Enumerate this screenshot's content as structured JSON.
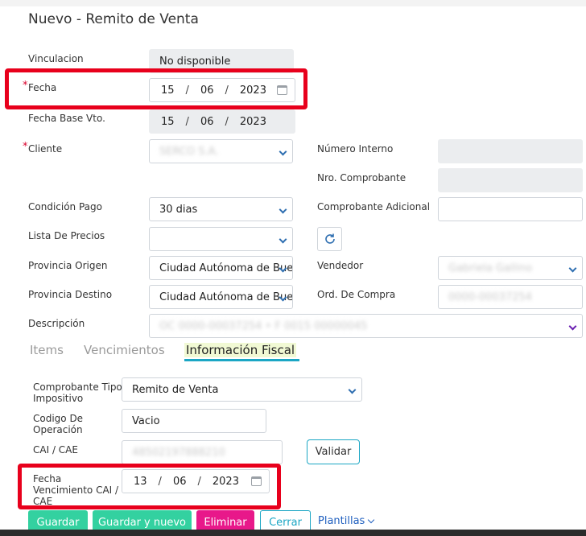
{
  "header": {
    "title": "Nuevo - Remito de Venta"
  },
  "form": {
    "vinculacion": {
      "label": "Vinculacion",
      "value": "No disponible"
    },
    "fecha": {
      "label": "Fecha",
      "day": "15",
      "month": "06",
      "year": "2023"
    },
    "fecha_base_vto": {
      "label": "Fecha Base Vto.",
      "day": "15",
      "month": "06",
      "year": "2023"
    },
    "cliente": {
      "label": "Cliente",
      "value": "SERCO S.A."
    },
    "numero_interno": {
      "label": "Número Interno",
      "value": ""
    },
    "nro_comprobante": {
      "label": "Nro. Comprobante",
      "value": ""
    },
    "condicion_pago": {
      "label": "Condición Pago",
      "value": "30 dias"
    },
    "comprobante_adicional": {
      "label": "Comprobante Adicional",
      "value": ""
    },
    "lista_precios": {
      "label": "Lista De Precios",
      "value": ""
    },
    "provincia_origen": {
      "label": "Provincia Origen",
      "value": "Ciudad Autónoma de Buenos Aires"
    },
    "vendedor": {
      "label": "Vendedor",
      "value": "Gabriela Gallino"
    },
    "provincia_destino": {
      "label": "Provincia Destino",
      "value": "Ciudad Autónoma de Buenos Aires"
    },
    "ord_compra": {
      "label": "Ord. De Compra",
      "value": "0000-00037254"
    },
    "descripcion": {
      "label": "Descripción",
      "value": "OC 0000-00037254 • F 0015 00000045"
    }
  },
  "tabs": [
    {
      "label": "Items"
    },
    {
      "label": "Vencimientos"
    },
    {
      "label": "Información Fiscal"
    }
  ],
  "fiscal": {
    "comprobante_tipo": {
      "label_line1": "Comprobante Tipo",
      "label_line2": "Impositivo",
      "value": "Remito de Venta"
    },
    "codigo_operacion": {
      "label_line1": "Codigo De",
      "label_line2": "Operación",
      "value": "Vacio"
    },
    "cai_cae": {
      "label": "CAI / CAE",
      "value": "48502197888210",
      "validate_label": "Validar"
    },
    "fecha_venc": {
      "label_line1": "Fecha",
      "label_line2": "Vencimiento CAI /",
      "label_line3": "CAE",
      "day": "13",
      "month": "06",
      "year": "2023"
    }
  },
  "actions": {
    "guardar": "Guardar",
    "guardar_nuevo": "Guardar y nuevo",
    "eliminar": "Eliminar",
    "cerrar": "Cerrar",
    "plantillas": "Plantillas"
  },
  "colors": {
    "required": "#d9002c",
    "highlight": "#e8001c",
    "accent": "#1ba6c4",
    "save_green": "#33d1a0",
    "delete_pink": "#e8188a",
    "link_blue": "#1f5fbf"
  }
}
